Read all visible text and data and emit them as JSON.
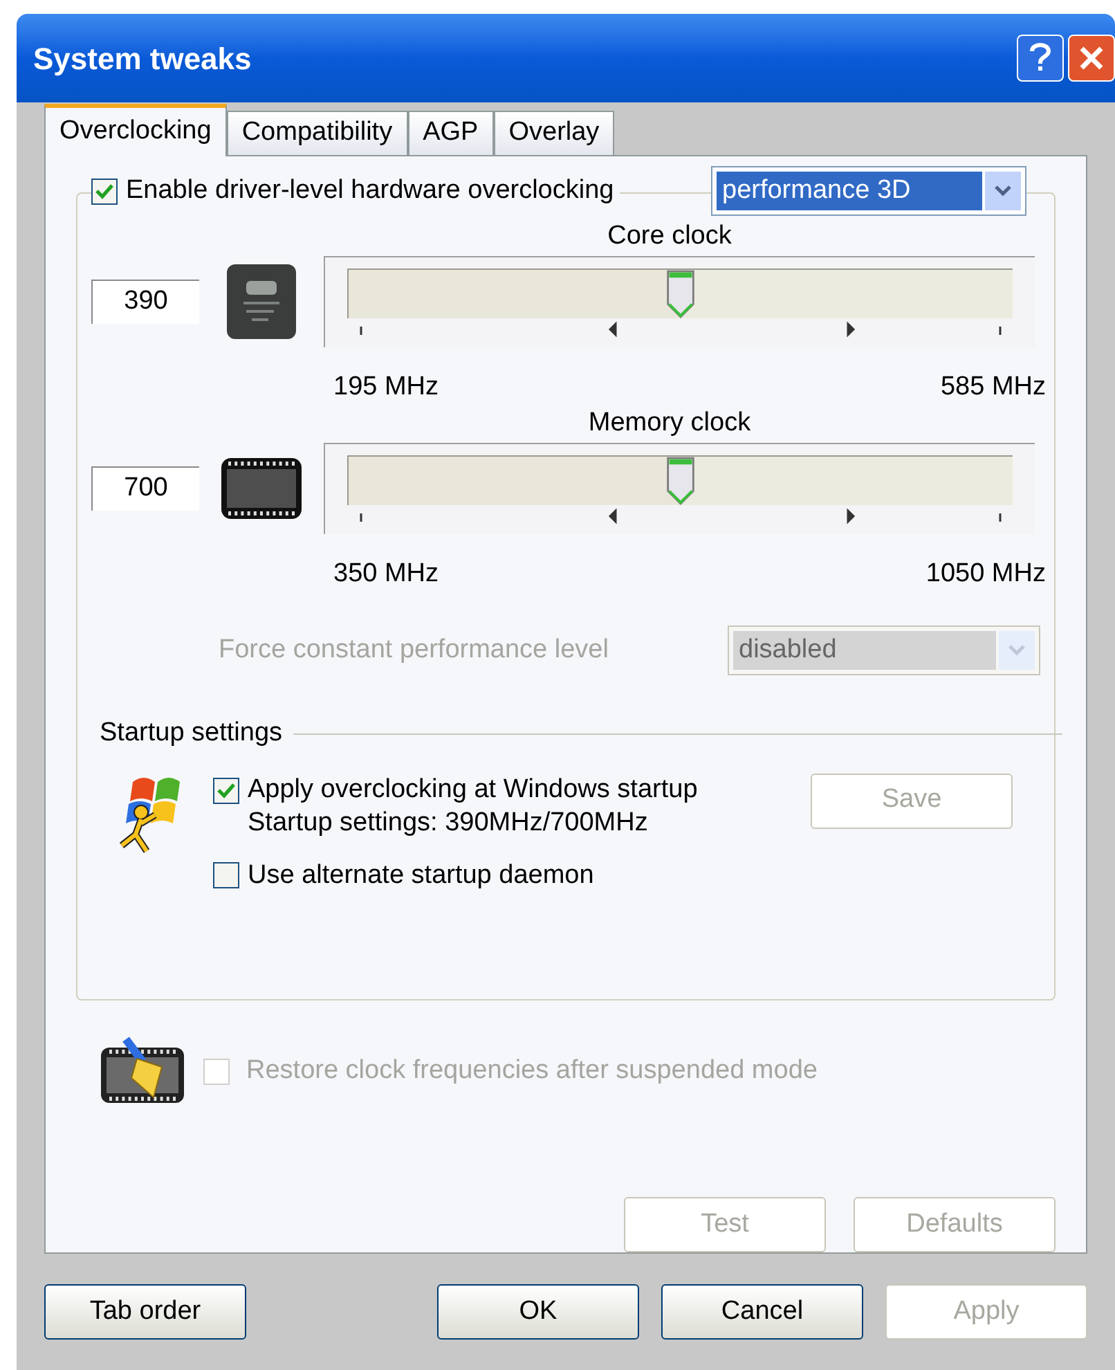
{
  "window": {
    "title": "System tweaks"
  },
  "tabs": [
    {
      "label": "Overclocking",
      "selected": true
    },
    {
      "label": "Compatibility",
      "selected": false
    },
    {
      "label": "AGP",
      "selected": false
    },
    {
      "label": "Overlay",
      "selected": false
    }
  ],
  "overclocking": {
    "enable": {
      "label": "Enable driver-level hardware overclocking",
      "checked": true
    },
    "profile": "performance 3D",
    "clocks": [
      {
        "kind": "core",
        "title": "Core clock",
        "value": "390",
        "level": 0.5,
        "min": "195 MHz",
        "max": "585 MHz"
      },
      {
        "kind": "memory",
        "title": "Memory clock",
        "value": "700",
        "level": 0.5,
        "min": "350 MHz",
        "max": "1050 MHz"
      }
    ],
    "force": {
      "label": "Force constant performance level",
      "value": "disabled",
      "disabled": true
    }
  },
  "startup": {
    "title": "Startup settings",
    "apply": {
      "label": "Apply overclocking at Windows startup",
      "detail": "Startup settings: 390MHz/700MHz",
      "checked": true
    },
    "save": {
      "label": "Save",
      "disabled": true
    },
    "alternate": {
      "label": "Use alternate startup daemon",
      "checked": false
    }
  },
  "restore": {
    "label": "Restore clock frequencies after suspended mode",
    "checked": false,
    "disabled": true
  },
  "actions": [
    {
      "label": "Test",
      "disabled": true
    },
    {
      "label": "Defaults",
      "disabled": true
    }
  ],
  "footer": [
    {
      "label": "Tab order",
      "disabled": false
    },
    {
      "label": "OK",
      "disabled": false
    },
    {
      "label": "Cancel",
      "disabled": false
    },
    {
      "label": "Apply",
      "disabled": true
    }
  ]
}
